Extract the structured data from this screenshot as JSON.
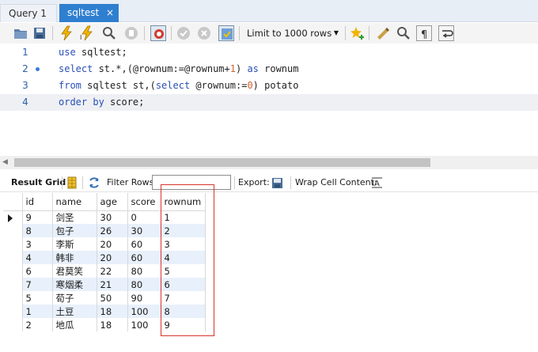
{
  "tabs": [
    {
      "label": "Query 1",
      "active": false
    },
    {
      "label": "sqltest",
      "active": true,
      "close_glyph": "×"
    }
  ],
  "toolbar": {
    "icons": [
      "open-folder-icon",
      "save-icon",
      "execute-icon",
      "execute-current-icon",
      "explain-icon",
      "stop-icon",
      "toggle-continue-on-error-icon",
      "commit-icon",
      "rollback-icon",
      "toggle-autocommit-icon",
      "add-snippet-icon",
      "beautify-icon",
      "find-icon",
      "invisible-chars-icon",
      "wrap-lines-icon"
    ],
    "limit_label": "Limit to 1000 rows"
  },
  "editor": {
    "lines": [
      {
        "num": "1",
        "has_dot": false
      },
      {
        "num": "2",
        "has_dot": true
      },
      {
        "num": "3",
        "has_dot": false
      },
      {
        "num": "4",
        "has_dot": false
      }
    ],
    "line1": {
      "kw": "use",
      "rest": " sqltest;"
    },
    "line2": {
      "kw1": "select",
      "p1": " st.*,(@rownum:=@rownum+",
      "n1": "1",
      "p2": ") ",
      "kw2": "as",
      "p3": " rownum"
    },
    "line3": {
      "kw1": "from",
      "p1": " sqltest st,(",
      "kw2": "select",
      "p2": " @rownum:=",
      "n1": "0",
      "p3": ") potato"
    },
    "line4": {
      "kw1": "order by",
      "p1": " score;"
    }
  },
  "result_toolbar": {
    "result_grid_label": "Result Grid",
    "filter_rows_label": "Filter Rows:",
    "filter_value": "",
    "export_label": "Export:",
    "wrap_label": "Wrap Cell Content:"
  },
  "grid": {
    "columns": [
      "id",
      "name",
      "age",
      "score",
      "rownum"
    ],
    "rows": [
      [
        "9",
        "剑圣",
        "30",
        "0",
        "1"
      ],
      [
        "8",
        "包子",
        "26",
        "30",
        "2"
      ],
      [
        "3",
        "李斯",
        "20",
        "60",
        "3"
      ],
      [
        "4",
        "韩非",
        "20",
        "60",
        "4"
      ],
      [
        "6",
        "君莫笑",
        "22",
        "80",
        "5"
      ],
      [
        "7",
        "寒烟柔",
        "21",
        "80",
        "6"
      ],
      [
        "5",
        "荀子",
        "50",
        "90",
        "7"
      ],
      [
        "1",
        "土豆",
        "18",
        "100",
        "8"
      ],
      [
        "2",
        "地瓜",
        "18",
        "100",
        "9"
      ]
    ]
  },
  "colors": {
    "accent_tab": "#2f7fd0",
    "keyword": "#2a4fb5",
    "number": "#d0602a",
    "annotation_box": "#d9342b",
    "alt_row": "#e8f0fb"
  }
}
